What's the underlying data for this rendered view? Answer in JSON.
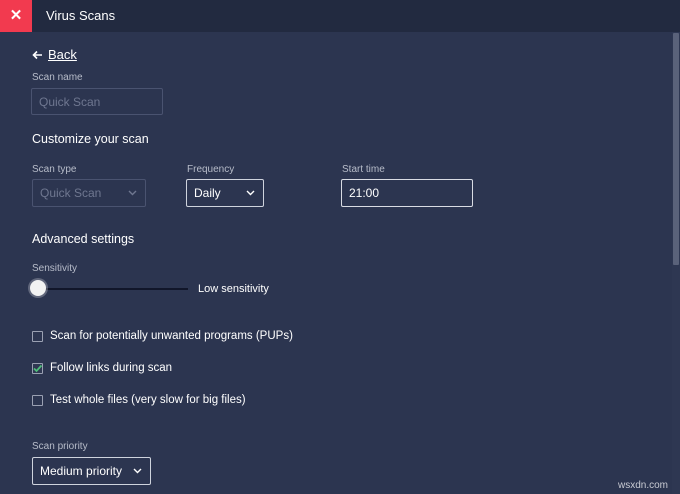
{
  "window": {
    "title": "Virus Scans",
    "close_glyph": "✕"
  },
  "back": {
    "label": "Back"
  },
  "scan_name": {
    "label": "Scan name",
    "placeholder": "Quick Scan"
  },
  "customize": {
    "heading": "Customize your scan",
    "scan_type": {
      "label": "Scan type",
      "value": "Quick Scan"
    },
    "frequency": {
      "label": "Frequency",
      "value": "Daily"
    },
    "start_time": {
      "label": "Start time",
      "value": "21:00"
    }
  },
  "advanced": {
    "heading": "Advanced settings",
    "sensitivity": {
      "label": "Sensitivity",
      "value_text": "Low sensitivity",
      "level": 0
    },
    "options": [
      {
        "label": "Scan for potentially unwanted programs (PUPs)",
        "checked": false
      },
      {
        "label": "Follow links during scan",
        "checked": true
      },
      {
        "label": "Test whole files (very slow for big files)",
        "checked": false
      }
    ]
  },
  "priority": {
    "label": "Scan priority",
    "value": "Medium priority"
  },
  "watermark": "wsxdn.com",
  "colors": {
    "close_bg": "#f23a4f",
    "check_green": "#4fbf7a",
    "background": "#2c3550"
  }
}
